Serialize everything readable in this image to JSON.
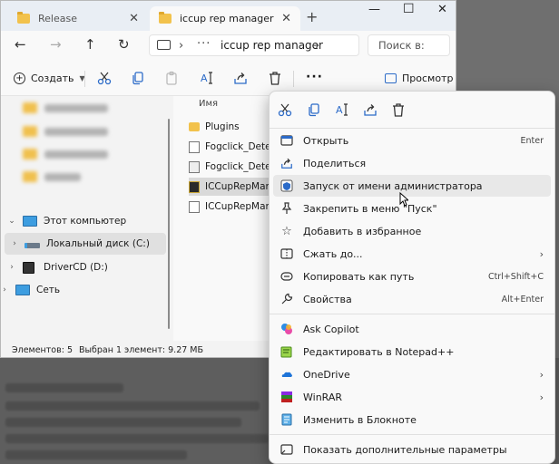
{
  "tabs": [
    {
      "label": "Release",
      "active": false
    },
    {
      "label": "iccup rep manager",
      "active": true
    }
  ],
  "address": {
    "crumb": "iccup rep manager",
    "search_placeholder": "Поиск в:"
  },
  "toolbar": {
    "create_label": "Создать",
    "preview_label": "Просмотр"
  },
  "sidebar": {
    "items": [
      {
        "label": "Этот компьютер",
        "expanded": true
      },
      {
        "label": "Локальный диск (C:)",
        "selected": true
      },
      {
        "label": "DriverCD (D:)"
      },
      {
        "label": "Сеть"
      }
    ]
  },
  "files": {
    "column_name": "Имя",
    "rows": [
      {
        "name": "Plugins",
        "icon": "folder-icon"
      },
      {
        "name": "Fogclick_Detecto",
        "icon": "text-file-icon"
      },
      {
        "name": "Fogclick_Detecto",
        "icon": "settings-file-icon"
      },
      {
        "name": "ICCupRepManag",
        "icon": "app-icon",
        "selected": true
      },
      {
        "name": "ICCupRepManag",
        "icon": "config-file-icon"
      }
    ]
  },
  "status": {
    "count": "Элементов: 5",
    "selection": "Выбран 1 элемент: 9.27 МБ"
  },
  "context_menu": {
    "items": [
      {
        "label": "Открыть",
        "shortcut": "Enter",
        "icon": "open-icon"
      },
      {
        "label": "Поделиться",
        "shortcut": "",
        "icon": "share-icon"
      },
      {
        "label": "Запуск от имени администратора",
        "shortcut": "",
        "icon": "shield-icon",
        "hover": true
      },
      {
        "label": "Закрепить в меню \"Пуск\"",
        "shortcut": "",
        "icon": "pin-icon"
      },
      {
        "label": "Добавить в избранное",
        "shortcut": "",
        "icon": "star-icon"
      },
      {
        "label": "Сжать до...",
        "shortcut": "",
        "icon": "zip-icon",
        "submenu": true
      },
      {
        "label": "Копировать как путь",
        "shortcut": "Ctrl+Shift+C",
        "icon": "copy-path-icon"
      },
      {
        "label": "Свойства",
        "shortcut": "Alt+Enter",
        "icon": "wrench-icon"
      },
      {
        "label": "Ask Copilot",
        "shortcut": "",
        "icon": "copilot-icon"
      },
      {
        "label": "Редактировать в Notepad++",
        "shortcut": "",
        "icon": "notepadpp-icon"
      },
      {
        "label": "OneDrive",
        "shortcut": "",
        "icon": "onedrive-icon",
        "submenu": true
      },
      {
        "label": "WinRAR",
        "shortcut": "",
        "icon": "winrar-icon",
        "submenu": true
      },
      {
        "label": "Изменить в Блокноте",
        "shortcut": "",
        "icon": "notepad-icon"
      },
      {
        "label": "Показать дополнительные параметры",
        "shortcut": "",
        "icon": "more-options-icon"
      }
    ]
  },
  "colors": {
    "accent": "#2c6bc8",
    "folder": "#f2c24c"
  }
}
